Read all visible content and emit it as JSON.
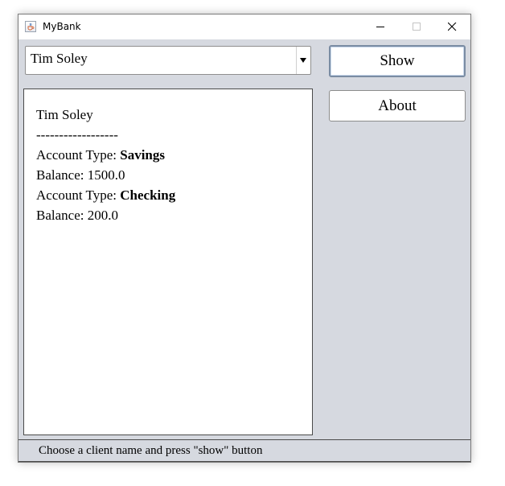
{
  "window": {
    "title": "MyBank",
    "icon": "java-cup-icon"
  },
  "client_selector": {
    "selected_value": "Tim Soley"
  },
  "buttons": {
    "show_label": "Show",
    "about_label": "About"
  },
  "output": {
    "client_name": "Tim Soley",
    "separator": "------------------",
    "accounts": [
      {
        "type_label": "Account Type: ",
        "type": "Savings",
        "balance_label": "Balance: ",
        "balance": "1500.0"
      },
      {
        "type_label": "Account Type: ",
        "type": "Checking",
        "balance_label": "Balance: ",
        "balance": "200.0"
      }
    ]
  },
  "status": {
    "text": "Choose a client name and press \"show\" button"
  }
}
